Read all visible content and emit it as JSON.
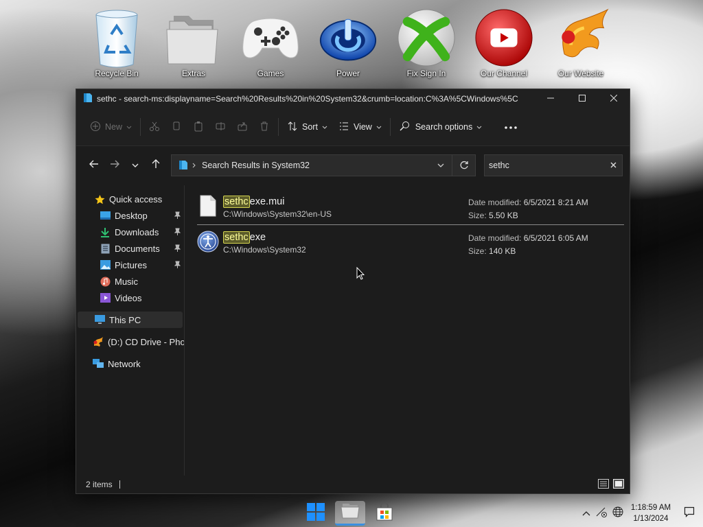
{
  "desktop": {
    "icons": [
      {
        "label": "Recycle Bin",
        "icon": "recycle-bin-icon"
      },
      {
        "label": "Extras",
        "icon": "folder-stack-icon"
      },
      {
        "label": "Games",
        "icon": "gamepad-icon"
      },
      {
        "label": "Power",
        "icon": "power-icon"
      },
      {
        "label": "Fix Sign In",
        "icon": "xbox-icon"
      },
      {
        "label": "Our Channel",
        "icon": "youtube-icon"
      },
      {
        "label": "Our Website",
        "icon": "phoenix-icon"
      }
    ]
  },
  "window": {
    "title": "sethc - search-ms:displayname=Search%20Results%20in%20System32&crumb=location:C%3A%5CWindows%5C",
    "toolbar": {
      "new_label": "New",
      "sort_label": "Sort",
      "view_label": "View",
      "search_options_label": "Search options"
    },
    "address": {
      "breadcrumb": "Search Results in System32",
      "search_value": "sethc"
    },
    "sidebar": {
      "quick_access": "Quick access",
      "items": [
        "Desktop",
        "Downloads",
        "Documents",
        "Pictures",
        "Music",
        "Videos"
      ],
      "this_pc": "This PC",
      "cd_drive": "(D:) CD Drive - Phoenix",
      "network": "Network"
    },
    "results": [
      {
        "match": "sethc",
        "rest": "exe.mui",
        "path": "C:\\Windows\\System32\\en-US",
        "date_label": "Date modified:",
        "date": "6/5/2021 8:21 AM",
        "size_label": "Size:",
        "size": "5.50 KB"
      },
      {
        "match": "sethc",
        "rest": "exe",
        "path": "C:\\Windows\\System32",
        "date_label": "Date modified:",
        "date": "6/5/2021 6:05 AM",
        "size_label": "Size:",
        "size": "140 KB"
      }
    ],
    "status": {
      "count": "2 items"
    }
  },
  "taskbar": {
    "time": "1:18:59 AM",
    "date": "1/13/2024"
  }
}
